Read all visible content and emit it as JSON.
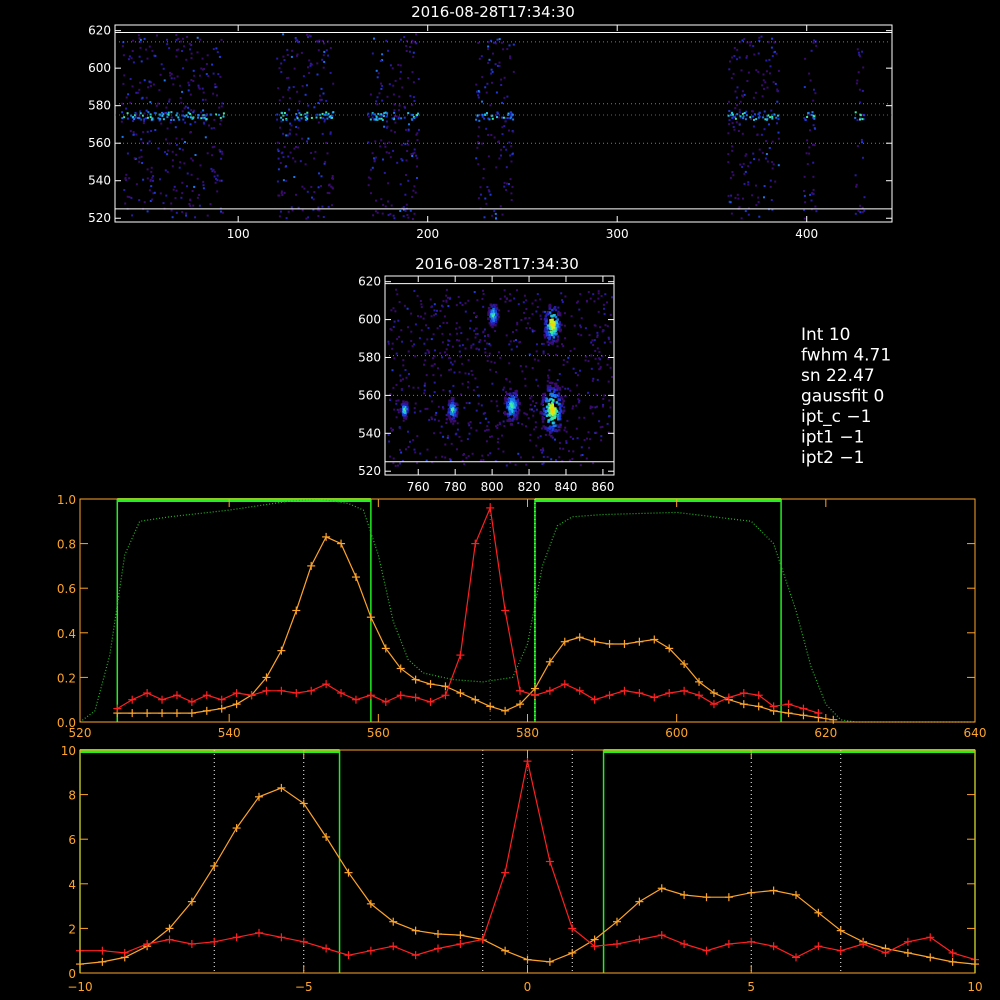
{
  "page": {
    "background": "#000000"
  },
  "colors": {
    "white": "#ffffff",
    "orange": "#ffa42a",
    "red": "#ff2020",
    "green": "#22ee22",
    "dotgreen": "#22bb22"
  },
  "panels": {
    "top": {
      "title": "2016-08-28T17:34:30"
    },
    "mid": {
      "title": "2016-08-28T17:34:30"
    }
  },
  "info": {
    "lines": [
      "Int      10",
      "fwhm     4.71",
      "sn      22.47",
      "gaussfit  0",
      "ipt_c   −1",
      "ipt1    −1",
      "ipt2    −1"
    ]
  },
  "chart_data": [
    {
      "type": "heatmap",
      "title": "2016-08-28T17:34:30",
      "xlim": [
        35,
        445
      ],
      "ylim": [
        518,
        623
      ],
      "x_ticks": [
        100,
        200,
        300,
        400
      ],
      "y_ticks": [
        520,
        540,
        560,
        580,
        600,
        620
      ],
      "h_lines": [
        {
          "y": 525,
          "style": "solid"
        },
        {
          "y": 560,
          "style": "dotted"
        },
        {
          "y": 575,
          "style": "dotted-red"
        },
        {
          "y": 581,
          "style": "dotted"
        },
        {
          "y": 614,
          "style": "dotted"
        },
        {
          "y": 619,
          "style": "solid"
        }
      ],
      "columns": [
        [
          38,
          92
        ],
        [
          120,
          150
        ],
        [
          168,
          195
        ],
        [
          225,
          245
        ],
        [
          358,
          385
        ],
        [
          398,
          405
        ],
        [
          425,
          430
        ]
      ]
    },
    {
      "type": "heatmap",
      "title": "2016-08-28T17:34:30",
      "xlim": [
        742,
        866
      ],
      "ylim": [
        518,
        623
      ],
      "x_ticks": [
        760,
        780,
        800,
        820,
        840,
        860
      ],
      "y_ticks": [
        520,
        540,
        560,
        580,
        600,
        620
      ],
      "h_lines": [
        {
          "y": 525,
          "style": "solid"
        },
        {
          "y": 581,
          "style": "dotted"
        },
        {
          "y": 560,
          "style": "dotted"
        },
        {
          "y": 619,
          "style": "solid"
        }
      ],
      "blobs": [
        [
          752,
          553,
          3
        ],
        [
          778,
          553,
          4
        ],
        [
          800,
          603,
          4
        ],
        [
          810,
          555,
          6
        ],
        [
          832,
          598,
          7
        ],
        [
          832,
          553,
          9
        ]
      ]
    },
    {
      "type": "line",
      "xlim": [
        520,
        640
      ],
      "ylim": [
        0,
        1.0
      ],
      "x_ticks": [
        520,
        540,
        560,
        580,
        600,
        620,
        640
      ],
      "y_ticks": [
        0.0,
        0.2,
        0.4,
        0.6,
        0.8,
        1.0
      ],
      "y_ticklabels": [
        "0.0",
        "0.2",
        "0.4",
        "0.6",
        "0.8",
        "1.0"
      ],
      "green_bars": [
        [
          525,
          559
        ],
        [
          581,
          614
        ]
      ],
      "vlines_dotted": [
        575,
        581
      ],
      "series": [
        {
          "color": "orange",
          "x": [
            525,
            527,
            529,
            531,
            533,
            535,
            537,
            539,
            541,
            543,
            545,
            547,
            549,
            551,
            553,
            555,
            557,
            559,
            561,
            563,
            565,
            567,
            569,
            571,
            573,
            575,
            577,
            579,
            581,
            583,
            585,
            587,
            589,
            591,
            593,
            595,
            597,
            599,
            601,
            603,
            605,
            607,
            609,
            611,
            613,
            615,
            617,
            619,
            621
          ],
          "y": [
            0.04,
            0.04,
            0.04,
            0.04,
            0.04,
            0.04,
            0.05,
            0.06,
            0.08,
            0.12,
            0.2,
            0.32,
            0.5,
            0.7,
            0.83,
            0.8,
            0.65,
            0.47,
            0.33,
            0.24,
            0.19,
            0.17,
            0.16,
            0.13,
            0.1,
            0.07,
            0.05,
            0.08,
            0.15,
            0.27,
            0.36,
            0.38,
            0.36,
            0.35,
            0.35,
            0.36,
            0.37,
            0.33,
            0.26,
            0.18,
            0.13,
            0.1,
            0.08,
            0.07,
            0.05,
            0.04,
            0.03,
            0.02,
            0.01
          ]
        },
        {
          "color": "red",
          "x": [
            525,
            527,
            529,
            531,
            533,
            535,
            537,
            539,
            541,
            543,
            545,
            547,
            549,
            551,
            553,
            555,
            557,
            559,
            561,
            563,
            565,
            567,
            569,
            571,
            573,
            575,
            577,
            579,
            581,
            583,
            585,
            587,
            589,
            591,
            593,
            595,
            597,
            599,
            601,
            603,
            605,
            607,
            609,
            611,
            613,
            615,
            617,
            619
          ],
          "y": [
            0.06,
            0.1,
            0.13,
            0.1,
            0.12,
            0.09,
            0.12,
            0.1,
            0.13,
            0.12,
            0.14,
            0.14,
            0.13,
            0.14,
            0.17,
            0.13,
            0.1,
            0.12,
            0.09,
            0.12,
            0.11,
            0.09,
            0.12,
            0.3,
            0.8,
            0.96,
            0.5,
            0.14,
            0.12,
            0.14,
            0.17,
            0.14,
            0.1,
            0.12,
            0.14,
            0.13,
            0.11,
            0.13,
            0.14,
            0.12,
            0.08,
            0.11,
            0.13,
            0.12,
            0.07,
            0.08,
            0.06,
            0.04
          ]
        },
        {
          "color": "dotgreen",
          "style": "dotted",
          "x": [
            520,
            522,
            524,
            526,
            528,
            532,
            540,
            548,
            552,
            556,
            558,
            560,
            562,
            564,
            566,
            570,
            574,
            578,
            580,
            582,
            584,
            586,
            590,
            600,
            610,
            613,
            616,
            618,
            620,
            622,
            624,
            630,
            640
          ],
          "y": [
            0.0,
            0.05,
            0.3,
            0.75,
            0.9,
            0.92,
            0.95,
            0.99,
            1.0,
            0.98,
            0.95,
            0.75,
            0.45,
            0.28,
            0.22,
            0.19,
            0.18,
            0.2,
            0.35,
            0.7,
            0.88,
            0.92,
            0.93,
            0.94,
            0.9,
            0.8,
            0.5,
            0.25,
            0.08,
            0.01,
            0.0,
            0.0,
            0.0
          ]
        }
      ]
    },
    {
      "type": "line",
      "xlim": [
        -10,
        10
      ],
      "ylim": [
        0,
        10
      ],
      "x_ticks": [
        -10,
        -5,
        0,
        5,
        10
      ],
      "y_ticks": [
        0,
        2,
        4,
        6,
        8,
        10
      ],
      "green_bars": [
        [
          -10,
          -4.2
        ],
        [
          1.7,
          10
        ]
      ],
      "vlines_dotted": [
        -7,
        -5,
        -1,
        0,
        1,
        5,
        7
      ],
      "series": [
        {
          "color": "orange",
          "x": [
            -10,
            -9.5,
            -9,
            -8.5,
            -8,
            -7.5,
            -7,
            -6.5,
            -6,
            -5.5,
            -5,
            -4.5,
            -4,
            -3.5,
            -3,
            -2.5,
            -2,
            -1.5,
            -1,
            -0.5,
            0,
            0.5,
            1,
            1.5,
            2,
            2.5,
            3,
            3.5,
            4,
            4.5,
            5,
            5.5,
            6,
            6.5,
            7,
            7.5,
            8,
            8.5,
            9,
            9.5,
            10
          ],
          "y": [
            0.4,
            0.5,
            0.7,
            1.2,
            2.0,
            3.2,
            4.8,
            6.5,
            7.9,
            8.3,
            7.6,
            6.1,
            4.5,
            3.1,
            2.3,
            1.9,
            1.75,
            1.7,
            1.5,
            1.0,
            0.6,
            0.5,
            0.9,
            1.5,
            2.3,
            3.2,
            3.8,
            3.5,
            3.4,
            3.4,
            3.6,
            3.7,
            3.5,
            2.7,
            1.9,
            1.4,
            1.1,
            0.9,
            0.7,
            0.5,
            0.4
          ]
        },
        {
          "color": "red",
          "x": [
            -10,
            -9.5,
            -9,
            -8.5,
            -8,
            -7.5,
            -7,
            -6.5,
            -6,
            -5.5,
            -5,
            -4.5,
            -4,
            -3.5,
            -3,
            -2.5,
            -2,
            -1.5,
            -1,
            -0.5,
            0,
            0.5,
            1,
            1.5,
            2,
            2.5,
            3,
            3.5,
            4,
            4.5,
            5,
            5.5,
            6,
            6.5,
            7,
            7.5,
            8,
            8.5,
            9,
            9.5,
            10
          ],
          "y": [
            1.0,
            1.0,
            0.9,
            1.3,
            1.5,
            1.3,
            1.4,
            1.6,
            1.8,
            1.6,
            1.4,
            1.1,
            0.8,
            1.0,
            1.2,
            0.8,
            1.1,
            1.3,
            1.5,
            4.5,
            9.5,
            5.0,
            2.0,
            1.2,
            1.3,
            1.5,
            1.7,
            1.3,
            1.0,
            1.3,
            1.4,
            1.2,
            0.7,
            1.2,
            1.0,
            1.3,
            0.9,
            1.4,
            1.6,
            0.9,
            0.6
          ]
        }
      ]
    }
  ]
}
